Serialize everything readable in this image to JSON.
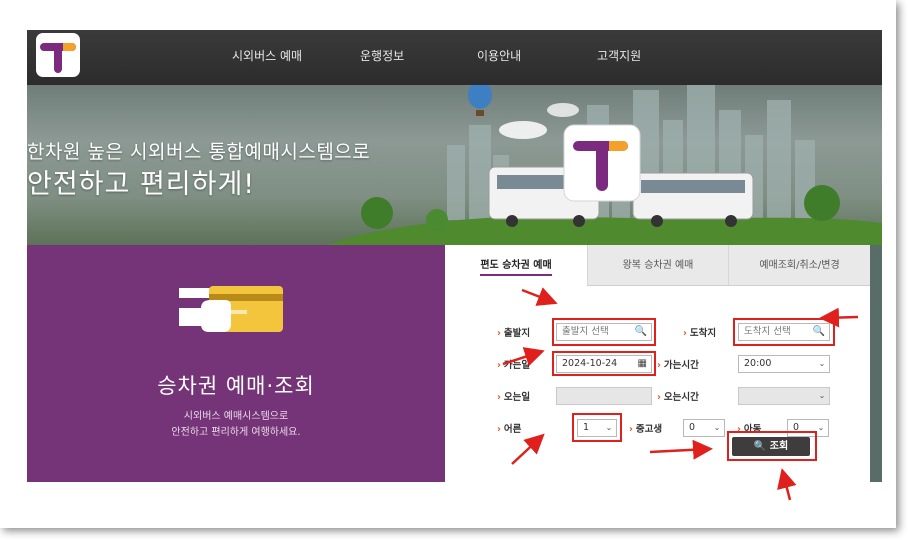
{
  "nav": {
    "items": [
      "시외버스 예매",
      "운행정보",
      "이용안내",
      "고객지원"
    ]
  },
  "hero": {
    "line1": "한차원 높은 시외버스 통합예매시스템으로",
    "line2": "안전하고 편리하게!"
  },
  "promo": {
    "title": "승차권 예매·조회",
    "sub1": "시외버스 예매시스템으로",
    "sub2": "안전하고 편리하게 여행하세요."
  },
  "tabs": [
    "편도 승차권 예매",
    "왕복 승차권 예매",
    "예매조회/취소/변경"
  ],
  "form": {
    "departure_label": "출발지",
    "departure_placeholder": "출발지 선택",
    "arrival_label": "도착지",
    "arrival_placeholder": "도착지 선택",
    "go_date_label": "가는일",
    "go_date_value": "2024-10-24",
    "go_time_label": "가는시간",
    "go_time_value": "20:00",
    "return_date_label": "오는일",
    "return_time_label": "오는시간",
    "adult_label": "어른",
    "adult_value": "1",
    "teen_label": "중고생",
    "teen_value": "0",
    "child_label": "아동",
    "child_value": "0",
    "search_label": "조회"
  },
  "colors": {
    "brand_purple": "#753477",
    "annotation_red": "#e0201c",
    "bullet_orange": "#e0551f"
  }
}
